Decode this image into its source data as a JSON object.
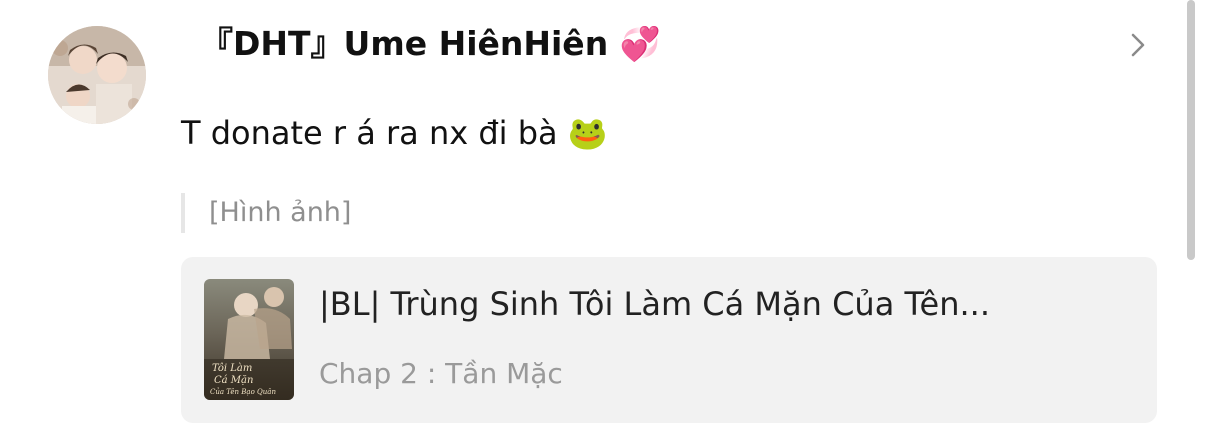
{
  "comment": {
    "username": "『DHT』Ume HiênHiên 💞",
    "message": "T donate r á ra nx đi bà 🐸",
    "quote": "[Hình ảnh]"
  },
  "story_card": {
    "title": "|BL| Trùng Sinh Tôi Làm Cá Mặn Của Tên...",
    "chapter": "Chap 2 : Tần Mặc",
    "cover_text": "Tôi Làm Cá Mặn Của Tên Bạo Quân"
  },
  "icons": {
    "chevron": "chevron-right-icon",
    "avatar": "avatar-image",
    "cover": "book-cover-image"
  },
  "colors": {
    "text_primary": "#111111",
    "text_secondary": "#9a9a9a",
    "card_bg": "#f2f2f2"
  }
}
